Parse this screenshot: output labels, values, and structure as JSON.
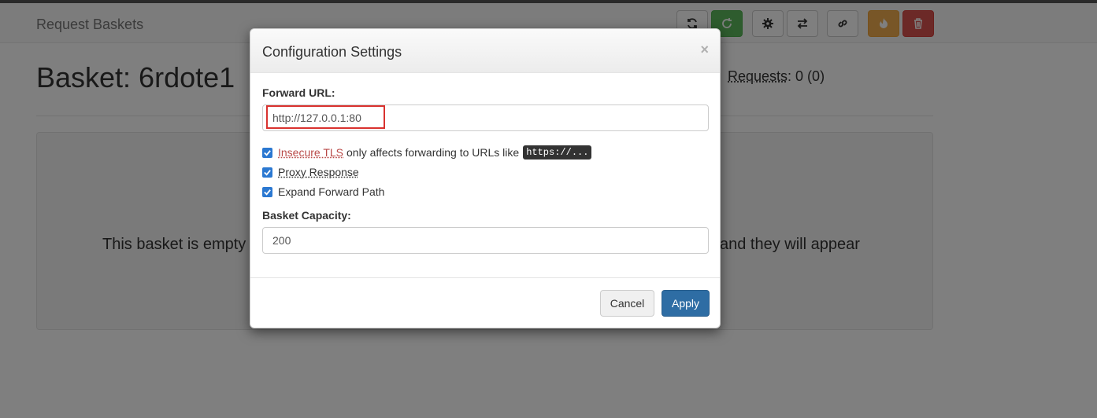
{
  "navbar": {
    "brand": "Request Baskets",
    "buttons": [
      {
        "name": "refresh-button",
        "icon": "refresh-icon"
      },
      {
        "name": "auto-refresh-button",
        "icon": "auto-refresh-icon"
      },
      {
        "name": "settings-button",
        "icon": "gear-icon"
      },
      {
        "name": "responses-button",
        "icon": "transfer-icon"
      },
      {
        "name": "share-button",
        "icon": "link-icon"
      },
      {
        "name": "clear-button",
        "icon": "fire-icon"
      },
      {
        "name": "delete-button",
        "icon": "trash-icon"
      }
    ]
  },
  "basket": {
    "title": "Basket: 6rdote1",
    "requests_label": "Requests",
    "requests_value": ": 0 (0)",
    "empty_text_left": "This basket is empty",
    "empty_text_right": "and they will appear"
  },
  "modal": {
    "title": "Configuration Settings",
    "close_symbol": "×",
    "forward_url_label": "Forward URL:",
    "forward_url_value": "http://127.0.0.1:80",
    "insecure_tls_label": "Insecure TLS",
    "insecure_tls_desc": "only affects forwarding to URLs like",
    "insecure_tls_code": "https://...",
    "proxy_response_label": "Proxy Response",
    "expand_forward_path_label": "Expand Forward Path",
    "capacity_label": "Basket Capacity:",
    "capacity_value": "200",
    "cancel_label": "Cancel",
    "apply_label": "Apply",
    "checks": {
      "insecure_tls": true,
      "proxy_response": true,
      "expand_forward_path": true
    }
  },
  "colors": {
    "primary": "#2e6da4",
    "success": "#5cb85c",
    "warning": "#f0ad4e",
    "danger": "#d9534f",
    "highlight": "#d9322f"
  }
}
